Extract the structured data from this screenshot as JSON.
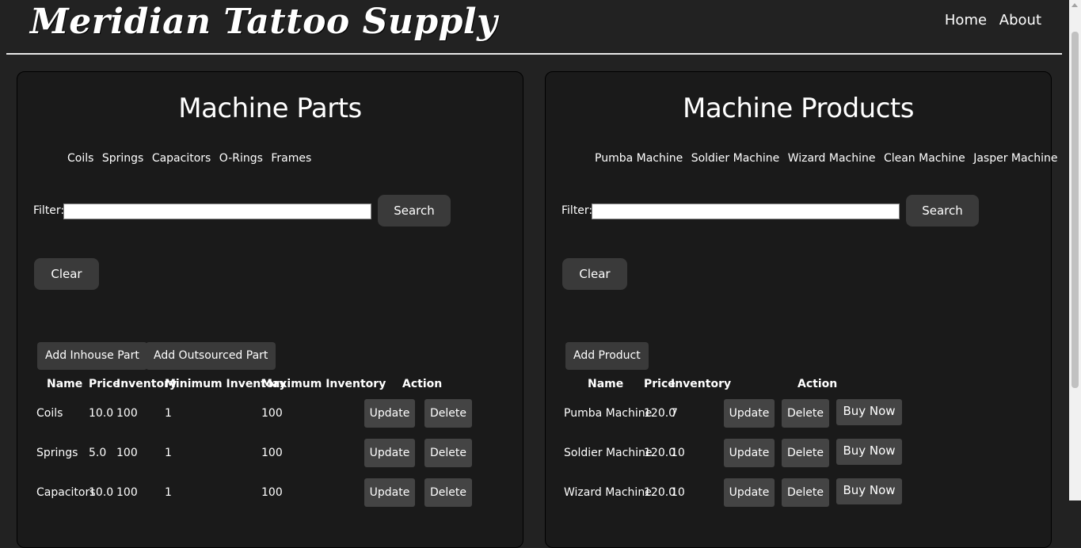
{
  "header": {
    "brand": "Meridian Tattoo Supply",
    "nav": [
      "Home",
      "About"
    ]
  },
  "parts": {
    "title": "Machine Parts",
    "categories": [
      "Coils",
      "Springs",
      "Capacitors",
      "O-Rings",
      "Frames"
    ],
    "filter_label": "Filter:",
    "filter_value": "",
    "search_label": "Search",
    "clear_label": "Clear",
    "add_inhouse_label": "Add Inhouse Part",
    "add_outsourced_label": "Add Outsourced Part",
    "columns": [
      "Name",
      "Price",
      "Inventory",
      "Minimum Inventory",
      "Maximum Inventory",
      "Action"
    ],
    "rows": [
      {
        "name": "Coils",
        "price": "10.0",
        "inventory": "100",
        "min": "1",
        "max": "100"
      },
      {
        "name": "Springs",
        "price": "5.0",
        "inventory": "100",
        "min": "1",
        "max": "100"
      },
      {
        "name": "Capacitors",
        "price": "10.0",
        "inventory": "100",
        "min": "1",
        "max": "100"
      }
    ],
    "update_label": "Update",
    "delete_label": "Delete"
  },
  "products": {
    "title": "Machine Products",
    "categories": [
      "Pumba Machine",
      "Soldier Machine",
      "Wizard Machine",
      "Clean Machine",
      "Jasper Machine"
    ],
    "filter_label": "Filter:",
    "filter_value": "",
    "search_label": "Search",
    "clear_label": "Clear",
    "add_product_label": "Add Product",
    "columns": [
      "Name",
      "Price",
      "Inventory",
      "Action"
    ],
    "rows": [
      {
        "name": "Pumba Machine",
        "price": "120.0",
        "inventory": "7"
      },
      {
        "name": "Soldier Machine",
        "price": "120.0",
        "inventory": "10"
      },
      {
        "name": "Wizard Machine",
        "price": "120.0",
        "inventory": "10"
      }
    ],
    "update_label": "Update",
    "delete_label": "Delete",
    "buy_label": "Buy Now"
  }
}
